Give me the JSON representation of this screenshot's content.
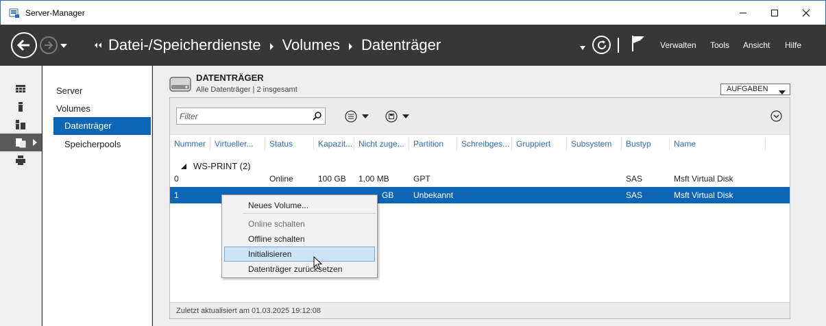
{
  "window": {
    "title": "Server-Manager"
  },
  "header": {
    "breadcrumb": [
      "Datei-/Speicherdienste",
      "Volumes",
      "Datenträger"
    ],
    "menu": [
      "Verwalten",
      "Tools",
      "Ansicht",
      "Hilfe"
    ]
  },
  "iconstrip": {
    "items": [
      "dashboard-icon",
      "local-server-icon",
      "all-servers-icon",
      "file-storage-icon",
      "print-services-icon"
    ]
  },
  "nav": {
    "items": [
      {
        "label": "Server"
      },
      {
        "label": "Volumes"
      },
      {
        "label": "Datenträger"
      },
      {
        "label": "Speicherpools"
      }
    ]
  },
  "section": {
    "title": "DATENTRÄGER",
    "subtitle": "Alle Datenträger | 2 insgesamt",
    "tasks_label": "AUFGABEN"
  },
  "toolbar": {
    "filter_placeholder": "Filter"
  },
  "columns": [
    "Nummer",
    "Virtueller...",
    "Status",
    "Kapazit...",
    "Nicht zuge...",
    "Partition",
    "Schreibges...",
    "Gruppiert",
    "Subsystem",
    "Bustyp",
    "Name"
  ],
  "group": {
    "label": "WS-PRINT (2)"
  },
  "rows": [
    {
      "nummer": "0",
      "virtuell": "",
      "status": "Online",
      "kapazitaet": "100 GB",
      "nicht_zugeordnet": "1,00 MB",
      "partition": "GPT",
      "schreibgeschuetzt": "",
      "gruppiert": "",
      "subsystem": "",
      "bustyp": "SAS",
      "name": "Msft Virtual Disk"
    },
    {
      "nummer": "1",
      "virtuell": "",
      "status": "",
      "kapazitaet": "",
      "nicht_zugeordnet": "GB",
      "partition": "Unbekannt",
      "schreibgeschuetzt": "",
      "gruppiert": "",
      "subsystem": "",
      "bustyp": "SAS",
      "name": "Msft Virtual Disk"
    }
  ],
  "status": {
    "last_updated": "Zuletzt aktualisiert am 01.03.2025 19:12:08"
  },
  "context_menu": {
    "items": [
      {
        "label": "Neues Volume...",
        "enabled": true
      },
      {
        "label": "Online schalten",
        "enabled": false
      },
      {
        "label": "Offline schalten",
        "enabled": true
      },
      {
        "label": "Initialisieren",
        "enabled": true,
        "highlighted": true
      },
      {
        "label": "Datenträger zurücksetzen",
        "enabled": true
      }
    ]
  },
  "colors": {
    "accent": "#0c66b5",
    "header_bg": "#373737",
    "column_header_text": "#2a6ebb"
  }
}
